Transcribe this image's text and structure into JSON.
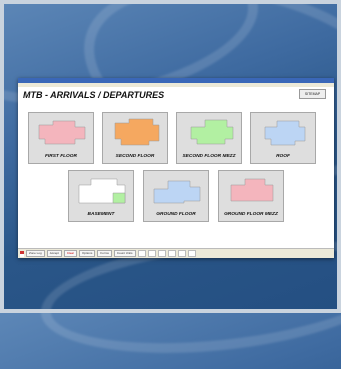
{
  "window": {
    "title_bar": "",
    "heading": "MTB - ARRIVALS / DEPARTURES",
    "sitemap_button": "SITEMAP"
  },
  "floors": [
    {
      "label": "FIRST FLOOR",
      "color": "#f4b5bd"
    },
    {
      "label": "SECOND FLOOR",
      "color": "#f5a860"
    },
    {
      "label": "SECOND FLOOR MEZZ",
      "color": "#b2f0a2"
    },
    {
      "label": "ROOF",
      "color": "#bcd5f4"
    },
    {
      "label": "BASEMENT",
      "color": "#ffffff"
    },
    {
      "label": "GROUND FLOOR",
      "color": "#bcd5f4"
    },
    {
      "label": "GROUND FLOOR MEZZ",
      "color": "#f4b5bd"
    }
  ],
  "statusbar": {
    "items": [
      "Zone Log",
      "Accept",
      "Clear",
      "Options",
      "Forms",
      "Count Units",
      "",
      "",
      "",
      "",
      "",
      ""
    ]
  }
}
